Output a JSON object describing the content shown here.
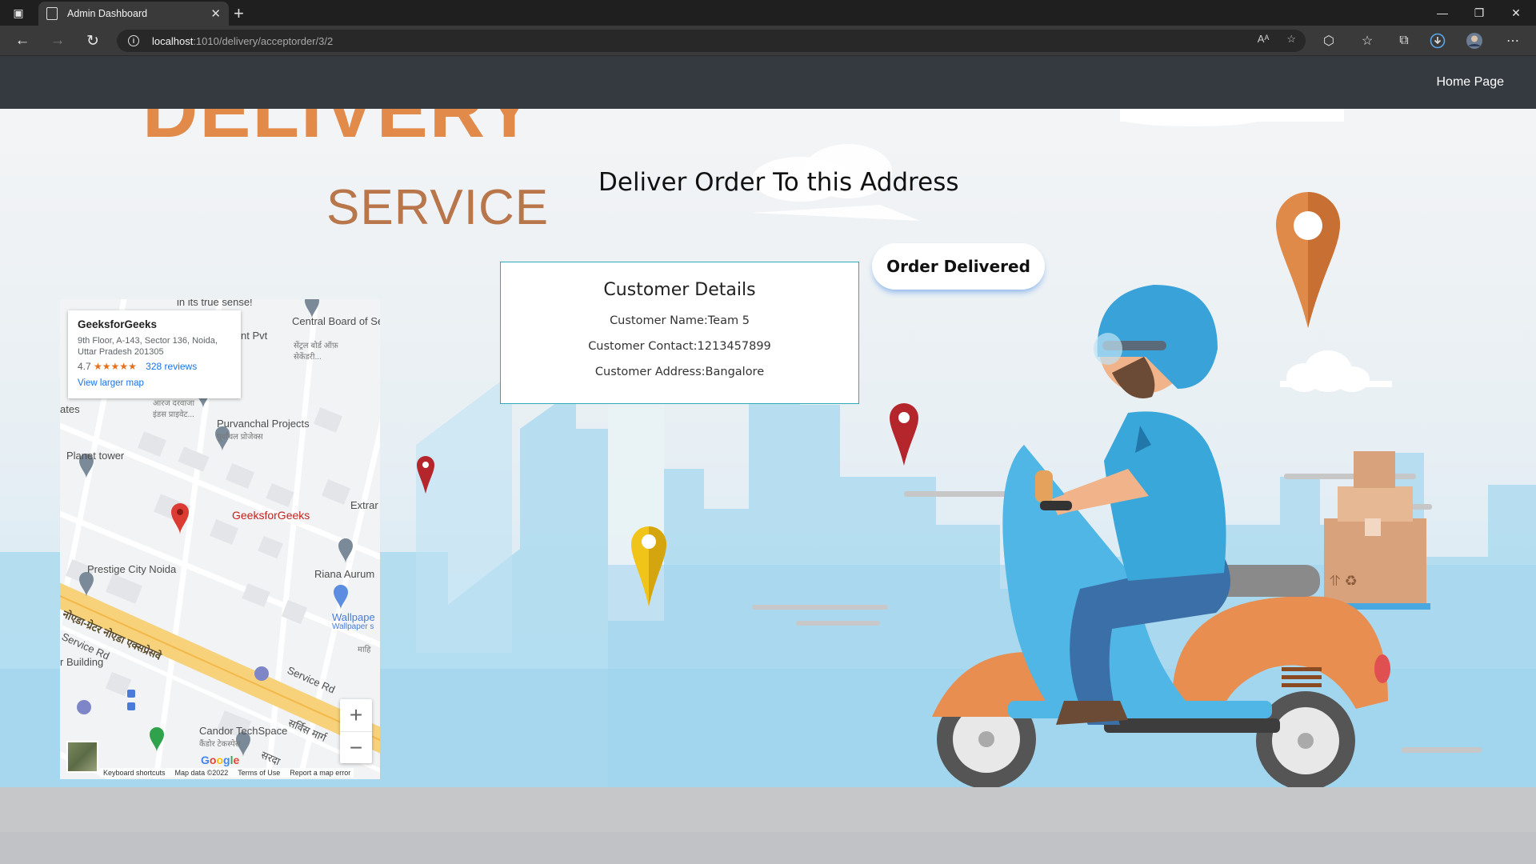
{
  "browser": {
    "tab_title": "Admin Dashboard",
    "url_host": "localhost",
    "url_path": ":1010/delivery/acceptorder/3/2"
  },
  "navbar": {
    "home_link": "Home Page"
  },
  "brand": {
    "line1": "DELIVERY",
    "line2": "SERVICE",
    "primary_color": "#e28a4a",
    "secondary_color": "#b8764a"
  },
  "page": {
    "heading": "Deliver Order To this Address",
    "order_button": "Order Delivered"
  },
  "customer": {
    "title": "Customer Details",
    "name_line": "Customer Name:Team 5",
    "contact_line": "Customer Contact:1213457899",
    "address_line": "Customer Address:Bangalore"
  },
  "map": {
    "place_name": "GeeksforGeeks",
    "place_address": "9th Floor, A-143, Sector 136, Noida, Uttar Pradesh 201305",
    "rating": "4.7",
    "stars": "★★★★★",
    "reviews": "328 reviews",
    "larger_map": "View larger map",
    "labels": {
      "true_sense": "in its true sense!",
      "cbse": "Central Board of Secondary Educa",
      "cbse_hi": "सेंट्रल बोर्ड ऑफ़ सेकेंडरी...",
      "pvt": "nt Pvt",
      "ates": "ates",
      "aaraj": "आरज दरवाजा इंडस प्राइवेट...",
      "purvanchal": "Purvanchal Projects",
      "purvanchal_hi": "पूर्वांचल प्रोजेक्स",
      "planet": "Planet tower",
      "gfg_pin": "GeeksforGeeks",
      "extra": "Extrar",
      "prestige": "Prestige City Noida",
      "riana": "Riana Aurum",
      "wallpaper": "Wallpape",
      "wallpaper2": "Wallpaper s",
      "expressway_hi": "नोएडा-ग्रेटर नोएडा एक्सप्रेसवे",
      "service_rd": "Service Rd",
      "service_rd2": "Service Rd",
      "building": "r Building",
      "candor": "Candor TechSpace",
      "candor_hi": "कैंडोर टेकस्पेस",
      "service_marg": "सर्विस मार्ग",
      "sarada": "सरदा",
      "mahi": "माहि"
    },
    "zoom_in": "+",
    "zoom_out": "−",
    "footer_shortcuts": "Keyboard shortcuts",
    "footer_data": "Map data ©2022",
    "footer_terms": "Terms of Use",
    "footer_report": "Report a map error",
    "google": "Google"
  }
}
